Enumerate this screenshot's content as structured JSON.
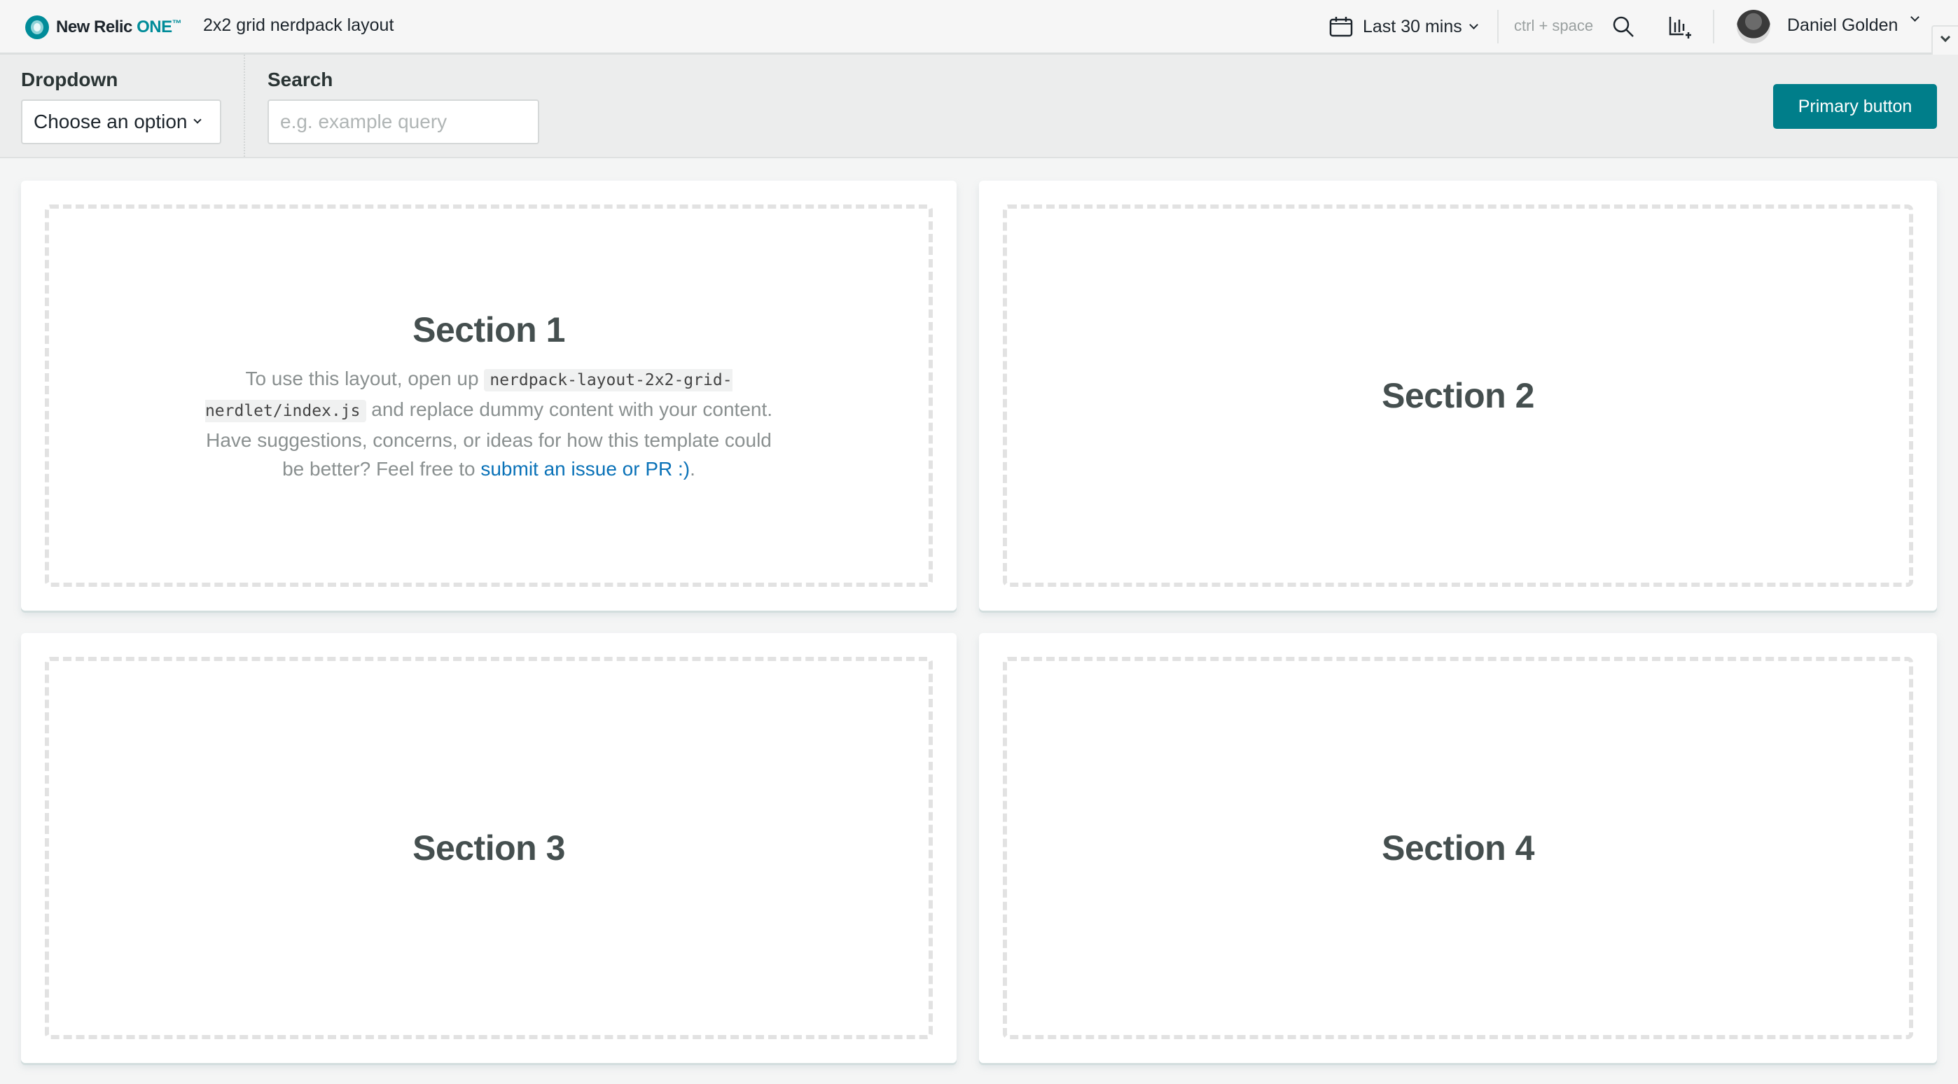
{
  "topnav": {
    "brand": {
      "name": "New Relic",
      "product": "ONE",
      "tm": "™"
    },
    "app_title": "2x2 grid nerdpack layout",
    "time_picker": {
      "label": "Last 30 mins",
      "icon": "calendar-icon"
    },
    "search_shortcut": "ctrl + space",
    "icons": [
      "search-icon",
      "add-chart-icon"
    ],
    "user": {
      "name": "Daniel Golden",
      "avatar": "avatar-photo"
    }
  },
  "toolbar": {
    "dropdown": {
      "label": "Dropdown",
      "value": "Choose an option"
    },
    "search": {
      "label": "Search",
      "placeholder": "e.g. example query",
      "value": ""
    },
    "primary_button": "Primary button"
  },
  "sections": [
    {
      "title": "Section 1",
      "body_parts": {
        "before_code": "To use this layout, open up ",
        "code": "nerdpack-layout-2x2-grid-nerdlet/index.js",
        "after_code": " and replace dummy content with your content. Have suggestions, concerns, or ideas for how this template could be better? Feel free to ",
        "link": "submit an issue or PR :)",
        "end": "."
      }
    },
    {
      "title": "Section 2"
    },
    {
      "title": "Section 3"
    },
    {
      "title": "Section 4"
    }
  ],
  "colors": {
    "brand_teal": "#008c99",
    "primary_button": "#007e8a",
    "link": "#0a72b8"
  }
}
